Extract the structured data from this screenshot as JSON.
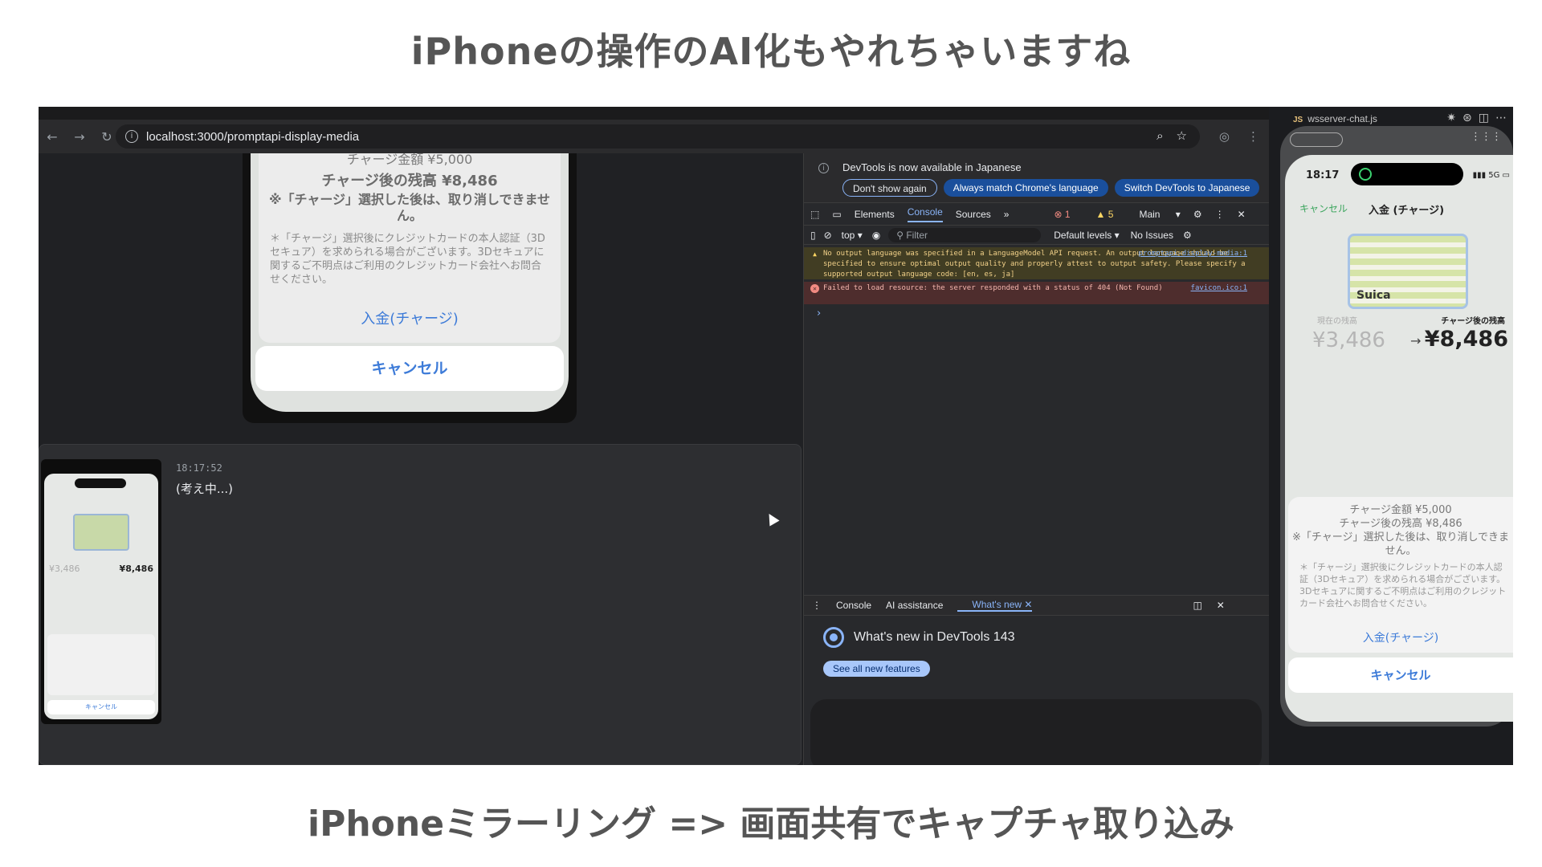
{
  "slide": {
    "title": "iPhoneの操作のAI化もやれちゃいますね",
    "caption": "iPhoneミラーリング => 画面共有でキャプチャ取り込み"
  },
  "browser": {
    "url": "localhost:3000/promptapi-display-media"
  },
  "page_phone": {
    "line1": "チャージ金額 ¥5,000",
    "line2": "チャージ後の残高 ¥8,486",
    "line3": "※「チャージ」選択した後は、取り消しできません。",
    "note": "＊「チャージ」選択後にクレジットカードの本人認証（3Dセキュア）を求められる場合がございます。3Dセキュアに関するご不明点はご利用のクレジットカード会社へお問合せください。",
    "charge": "入金(チャージ)",
    "cancel": "キャンセル"
  },
  "chat": {
    "timestamp": "18:17:52",
    "message": "(考え中...)",
    "thumb_amount_left": "¥3,486",
    "thumb_amount_right": "¥8,486",
    "thumb_cancel": "キャンセル"
  },
  "devtools": {
    "banner_text": "DevTools is now available in Japanese",
    "btn_dont_show": "Don't show again",
    "btn_match": "Always match Chrome's language",
    "btn_switch": "Switch DevTools to Japanese",
    "tabs": [
      "Elements",
      "Console",
      "Sources"
    ],
    "errors": "1",
    "warnings": "5",
    "context": "Main",
    "top": "top",
    "filter_placeholder": "Filter",
    "levels": "Default levels",
    "issues": "No Issues",
    "warn_text": "No output language was specified in a LanguageModel API request. An output language should be specified to ensure optimal output quality and properly attest to output safety. Please specify a supported output language code: [en, es, ja]",
    "warn_src": "promptapi-display-media:1",
    "err_text": "Failed to load resource: the server responded with a status of 404 (Not Found)",
    "err_src": "favicon.ico:1",
    "drawer_tabs": [
      "Console",
      "AI assistance",
      "What's new"
    ],
    "whats_new_title": "What's new in DevTools 143",
    "see_all": "See all new features"
  },
  "editor": {
    "file_tab": "wsserver-chat.js"
  },
  "mirror_phone": {
    "time": "18:17",
    "cancel_link": "キャンセル",
    "header": "入金 (チャージ)",
    "card_label": "Suica",
    "current_label": "現在の残高",
    "after_label": "チャージ後の残高",
    "amount_current": "¥3,486",
    "amount_after": "¥8,486",
    "sheet_line1": "チャージ金額 ¥5,000",
    "sheet_line2": "チャージ後の残高 ¥8,486",
    "sheet_line3": "※「チャージ」選択した後は、取り消しできません。",
    "sheet_note": "＊「チャージ」選択後にクレジットカードの本人認証（3Dセキュア）を求められる場合がございます。3Dセキュアに関するご不明点はご利用のクレジットカード会社へお問合せください。",
    "charge": "入金(チャージ)",
    "cancel": "キャンセル"
  }
}
